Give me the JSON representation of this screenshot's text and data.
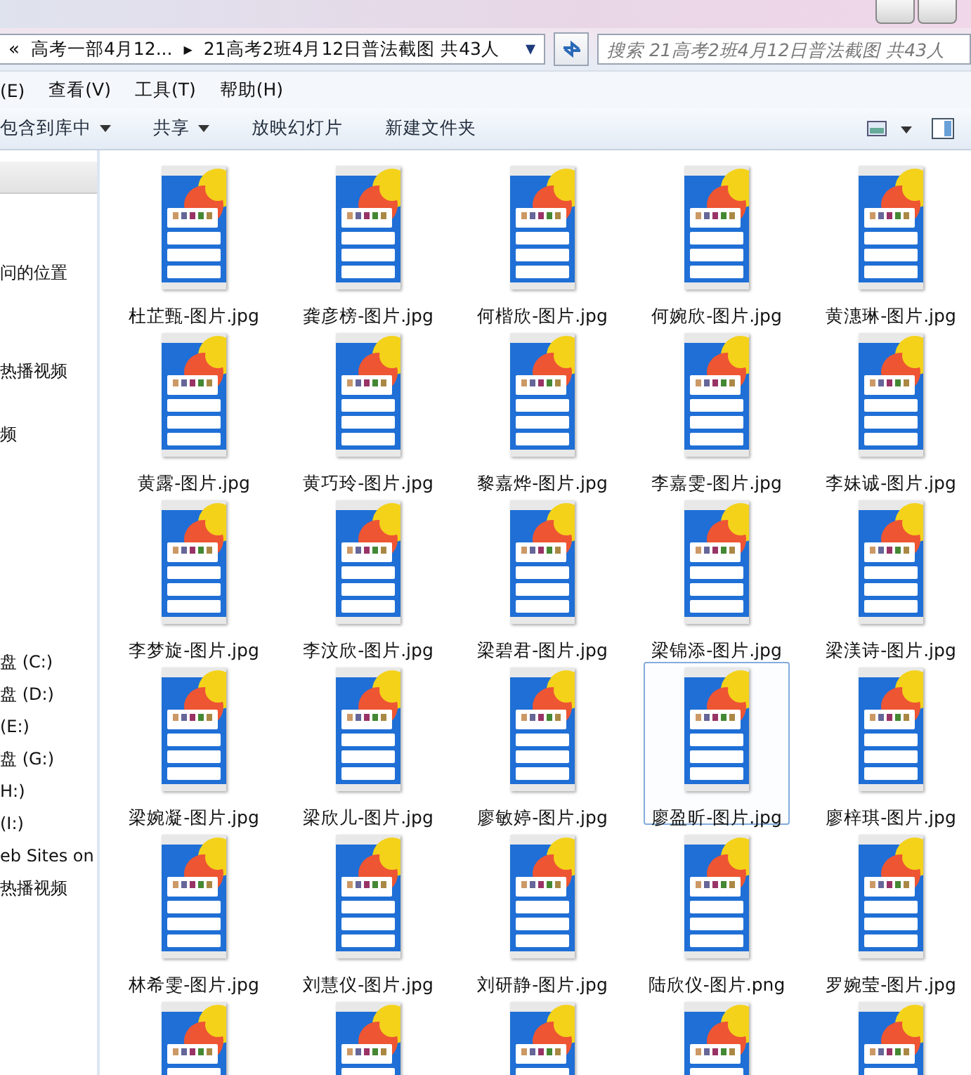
{
  "address_bar": {
    "back_chevron": "«",
    "crumbs": [
      {
        "label": "高考一部4月12..."
      },
      {
        "label": "21高考2班4月12日普法截图 共43人"
      }
    ],
    "separator": "▶",
    "dropdown": "▾"
  },
  "search": {
    "placeholder": "搜索 21高考2班4月12日普法截图 共43人"
  },
  "menu": [
    {
      "label": "(E)"
    },
    {
      "label": "查看(V)"
    },
    {
      "label": "工具(T)"
    },
    {
      "label": "帮助(H)"
    }
  ],
  "toolbar": [
    {
      "label": "包含到库中",
      "dropdown": true
    },
    {
      "label": "共享",
      "dropdown": true
    },
    {
      "label": "放映幻灯片",
      "dropdown": false
    },
    {
      "label": "新建文件夹",
      "dropdown": false
    }
  ],
  "sidebar": {
    "groups": [
      {
        "items": [
          {
            "label": "问的位置"
          }
        ]
      },
      {
        "items": [
          {
            "label": "热播视频"
          }
        ]
      },
      {
        "items": [
          {
            "label": "频"
          }
        ]
      },
      {
        "items": [
          {
            "label": "盘 (C:)"
          },
          {
            "label": "盘 (D:)"
          },
          {
            "label": " (E:)"
          },
          {
            "label": "盘 (G:)"
          },
          {
            "label": "H:)"
          },
          {
            "label": " (I:)"
          },
          {
            "label": "eb Sites on"
          },
          {
            "label": "热播视频"
          }
        ]
      }
    ]
  },
  "files": [
    {
      "kind": "file",
      "name": "杜芷甄-图片.jpg",
      "selected": false
    },
    {
      "kind": "file",
      "name": "龚彦榜-图片.jpg",
      "selected": false
    },
    {
      "kind": "file",
      "name": "何楷欣-图片.jpg",
      "selected": false
    },
    {
      "kind": "file",
      "name": "何婉欣-图片.jpg",
      "selected": false
    },
    {
      "kind": "file",
      "name": "黄潓琳-图片.jpg",
      "selected": false
    },
    {
      "kind": "file",
      "name": "黄露-图片.jpg",
      "selected": false
    },
    {
      "kind": "file",
      "name": "黄巧玲-图片.jpg",
      "selected": false
    },
    {
      "kind": "file",
      "name": "黎嘉烨-图片.jpg",
      "selected": false
    },
    {
      "kind": "file",
      "name": "李嘉雯-图片.jpg",
      "selected": false
    },
    {
      "kind": "file",
      "name": "李妹诚-图片.jpg",
      "selected": false
    },
    {
      "kind": "file",
      "name": "李梦旋-图片.jpg",
      "selected": false
    },
    {
      "kind": "file",
      "name": "李汶欣-图片.jpg",
      "selected": false
    },
    {
      "kind": "file",
      "name": "梁碧君-图片.jpg",
      "selected": false
    },
    {
      "kind": "file",
      "name": "梁锦添-图片.jpg",
      "selected": false
    },
    {
      "kind": "file",
      "name": "梁渼诗-图片.jpg",
      "selected": false
    },
    {
      "kind": "file",
      "name": "梁婉凝-图片.jpg",
      "selected": false
    },
    {
      "kind": "file",
      "name": "梁欣儿-图片.jpg",
      "selected": false
    },
    {
      "kind": "file",
      "name": "廖敏婷-图片.jpg",
      "selected": false
    },
    {
      "kind": "file",
      "name": "廖盈昕-图片.jpg",
      "selected": true
    },
    {
      "kind": "file",
      "name": "廖梓琪-图片.jpg",
      "selected": false
    },
    {
      "kind": "file",
      "name": "林希雯-图片.jpg",
      "selected": false
    },
    {
      "kind": "file",
      "name": "刘慧仪-图片.jpg",
      "selected": false
    },
    {
      "kind": "file",
      "name": "刘研静-图片.jpg",
      "selected": false
    },
    {
      "kind": "file",
      "name": "陆欣仪-图片.png",
      "selected": false
    },
    {
      "kind": "file",
      "name": "罗婉莹-图片.jpg",
      "selected": false
    },
    {
      "kind": "cut"
    },
    {
      "kind": "cut"
    },
    {
      "kind": "cut"
    },
    {
      "kind": "cut"
    },
    {
      "kind": "cut"
    }
  ]
}
